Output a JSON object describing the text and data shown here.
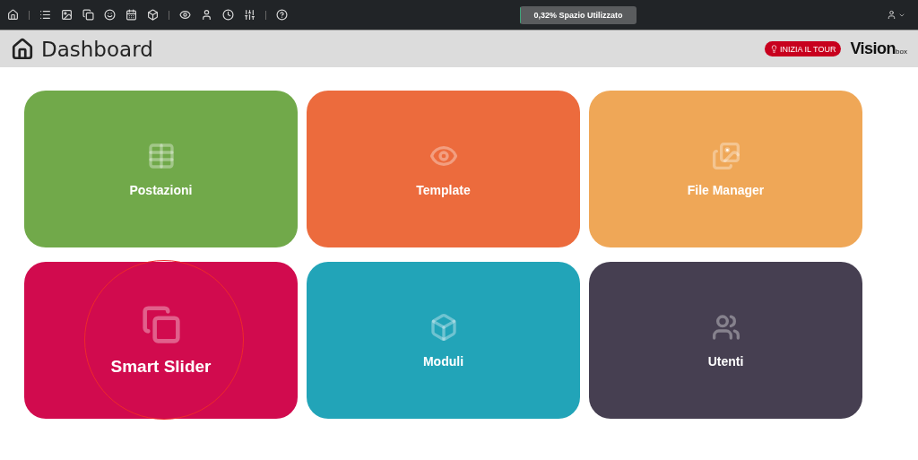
{
  "storage": {
    "label": "0,32% Spazio Utilizzato",
    "level": 0.0032
  },
  "header": {
    "title": "Dashboard",
    "tour_button": "INIZIA IL TOUR",
    "logo": {
      "main": "Vision",
      "sub": "box"
    }
  },
  "tiles": [
    {
      "label": "Postazioni",
      "color": "#71a94a",
      "highlighted": false
    },
    {
      "label": "Template",
      "color": "#ec6b3d",
      "highlighted": false
    },
    {
      "label": "File Manager",
      "color": "#efa757",
      "highlighted": false
    },
    {
      "label": "Smart Slider",
      "color": "#d10b4e",
      "highlighted": true
    },
    {
      "label": "Moduli",
      "color": "#22a4b8",
      "highlighted": false
    },
    {
      "label": "Utenti",
      "color": "#463f51",
      "highlighted": false
    }
  ]
}
